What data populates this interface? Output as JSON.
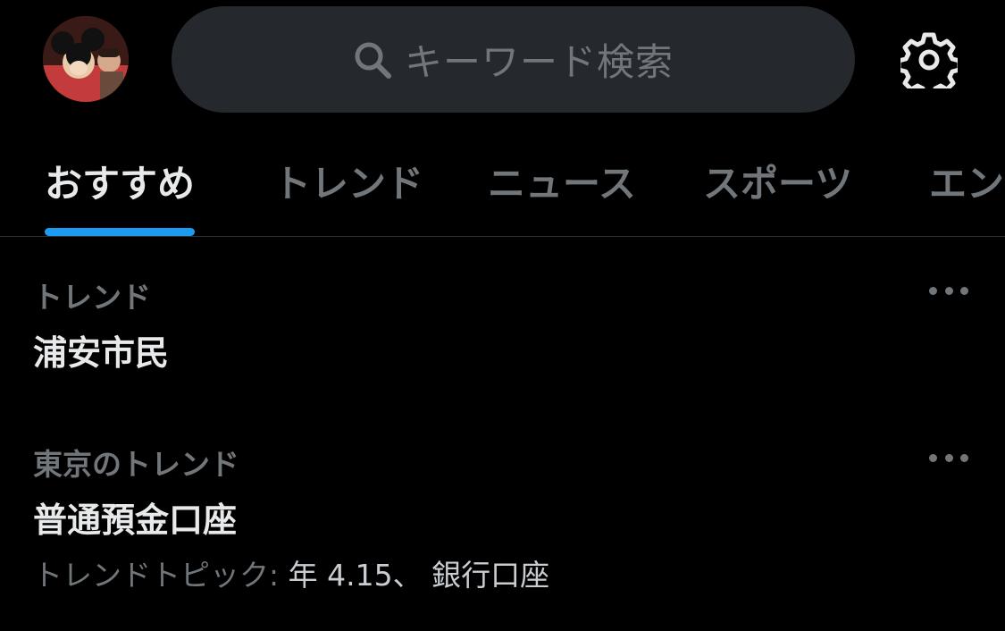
{
  "header": {
    "avatar_alt": "user avatar",
    "search": {
      "placeholder": "キーワード検索"
    }
  },
  "tabs": [
    {
      "label": "おすすめ",
      "active": true
    },
    {
      "label": "トレンド",
      "active": false
    },
    {
      "label": "ニュース",
      "active": false
    },
    {
      "label": "スポーツ",
      "active": false
    },
    {
      "label": "エン",
      "active": false
    }
  ],
  "trends": [
    {
      "context": "トレンド",
      "title": "浦安市民",
      "subtitle_prefix": "",
      "subtitle_topics": ""
    },
    {
      "context": "東京のトレンド",
      "title": "普通預金口座",
      "subtitle_prefix": "トレンドトピック: ",
      "subtitle_topics": "年 4.15、 銀行口座"
    }
  ],
  "colors": {
    "background": "#000000",
    "search_bg": "#25292e",
    "accent": "#1d9bf0",
    "muted_text": "#71767b",
    "primary_text": "#e7e9ea"
  }
}
